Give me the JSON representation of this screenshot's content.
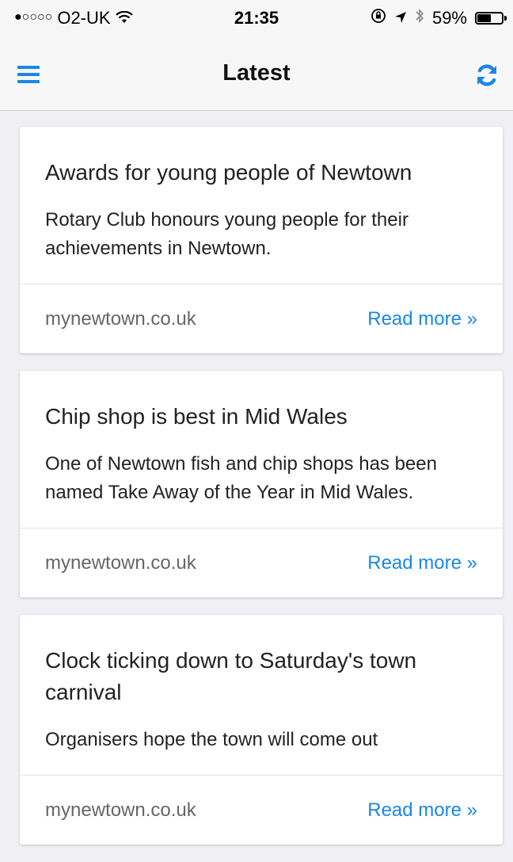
{
  "status_bar": {
    "signal": "●○○○○",
    "carrier": "O2-UK",
    "time": "21:35",
    "battery_text": "59%",
    "battery_level": 0.59
  },
  "nav": {
    "title": "Latest",
    "menu_icon": "hamburger-menu-icon",
    "refresh_icon": "refresh-icon",
    "accent_color": "#1b87e5"
  },
  "articles": [
    {
      "title": "Awards for young people of Newtown",
      "summary": "Rotary Club honours young people for their achievements in Newtown.",
      "source": "mynewtown.co.uk",
      "link_label": "Read more »"
    },
    {
      "title": "Chip shop is best in Mid Wales",
      "summary": "One of Newtown fish and chip shops has been named Take Away of the Year in Mid Wales.",
      "source": "mynewtown.co.uk",
      "link_label": "Read more »"
    },
    {
      "title": "Clock ticking down to Saturday's town carnival",
      "summary": "Organisers hope the town will come out",
      "source": "mynewtown.co.uk",
      "link_label": "Read more »"
    }
  ]
}
